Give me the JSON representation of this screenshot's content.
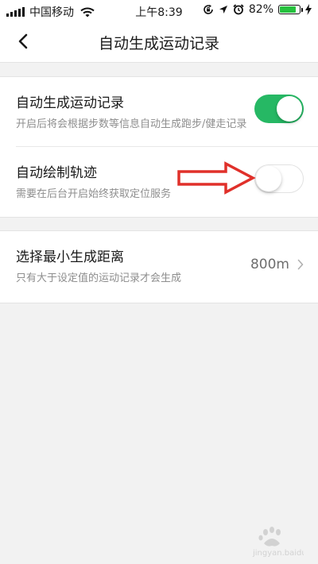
{
  "status_bar": {
    "carrier": "中国移动",
    "time": "上午8:39",
    "battery_text": "82%",
    "battery_level": 0.82,
    "icons": [
      "signal-icon",
      "wifi-icon",
      "rotation-lock-icon",
      "location-icon",
      "alarm-icon",
      "battery-icon",
      "charging-icon"
    ]
  },
  "nav": {
    "title": "自动生成运动记录",
    "back_icon": "chevron-left-icon"
  },
  "settings": {
    "auto_record": {
      "label": "自动生成运动记录",
      "description": "开启后将会根据步数等信息自动生成跑步/健走记录",
      "enabled": true
    },
    "auto_track": {
      "label": "自动绘制轨迹",
      "description": "需要在后台开启始终获取定位服务",
      "enabled": false
    },
    "min_distance": {
      "label": "选择最小生成距离",
      "description": "只有大于设定值的运动记录才会生成",
      "value": "800m",
      "chevron_icon": "chevron-right-icon"
    }
  },
  "colors": {
    "toggle_on": "#26b864",
    "annotation_arrow": "#e0302a",
    "background": "#f2f2f2"
  },
  "watermark": {
    "text": "jingyan.baidu.com"
  }
}
